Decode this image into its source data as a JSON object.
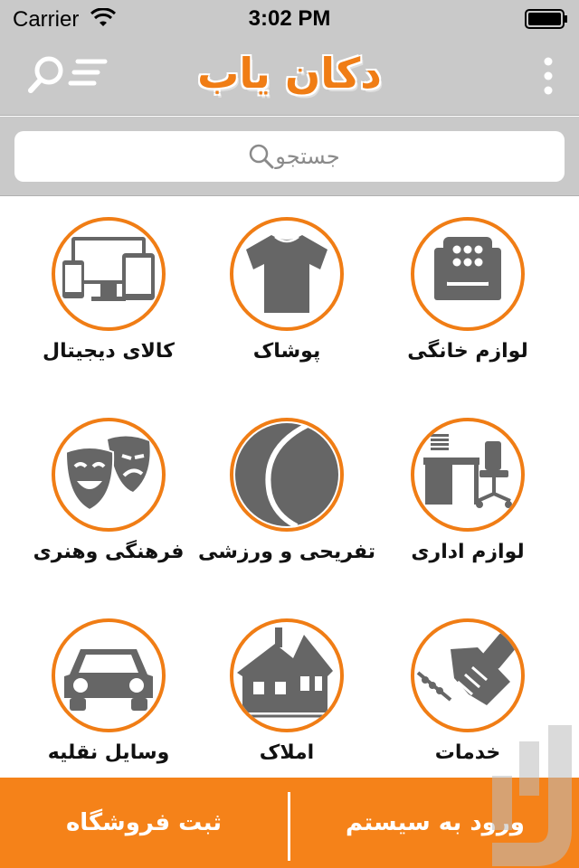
{
  "status_bar": {
    "carrier": "Carrier",
    "time": "3:02 PM",
    "wifi_icon": "wifi-icon",
    "battery_icon": "battery-icon"
  },
  "nav_bar": {
    "title": "دکان یاب",
    "menu_icon": "search-list-icon",
    "more_icon": "more-vertical-icon"
  },
  "search": {
    "placeholder": "جستجو",
    "icon": "search-icon"
  },
  "categories": [
    {
      "label": "لوازم خانگی",
      "icon": "armchair-icon"
    },
    {
      "label": "پوشاک",
      "icon": "tshirt-icon"
    },
    {
      "label": "کالای دیجیتال",
      "icon": "devices-icon"
    },
    {
      "label": "لوازم اداری",
      "icon": "office-desk-icon"
    },
    {
      "label": "تفریحی و ورزشی",
      "icon": "tennis-ball-icon"
    },
    {
      "label": "فرهنگی وهنری",
      "icon": "theater-masks-icon"
    },
    {
      "label": "خدمات",
      "icon": "handshake-icon"
    },
    {
      "label": "املاک",
      "icon": "house-icon"
    },
    {
      "label": "وسایل نقلیه",
      "icon": "car-icon"
    }
  ],
  "bottom_bar": {
    "login_label": "ورود به سیستم",
    "register_store_label": "ثبت فروشگاه"
  },
  "colors": {
    "accent": "#f07d15",
    "bar_gray": "#c9c9c9",
    "icon_gray": "#666666",
    "bottom_bar": "#f58219"
  }
}
